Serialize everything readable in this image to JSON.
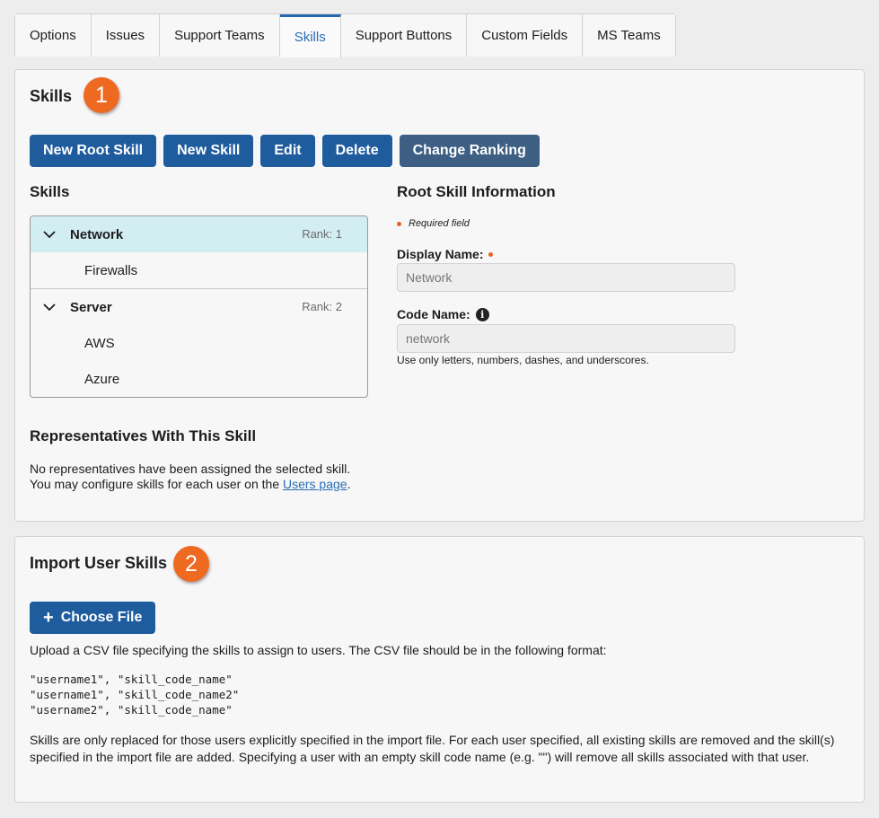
{
  "tabs": [
    "Options",
    "Issues",
    "Support Teams",
    "Skills",
    "Support Buttons",
    "Custom Fields",
    "MS Teams"
  ],
  "active_tab": "Skills",
  "skills_panel": {
    "title": "Skills",
    "badge": "1",
    "buttons": {
      "new_root": "New Root Skill",
      "new_skill": "New Skill",
      "edit": "Edit",
      "delete": "Delete",
      "change_ranking": "Change Ranking"
    },
    "tree_title": "Skills",
    "tree": [
      {
        "name": "Network",
        "rank": "Rank: 1",
        "children": [
          "Firewalls"
        ]
      },
      {
        "name": "Server",
        "rank": "Rank: 2",
        "children": [
          "AWS",
          "Azure"
        ]
      }
    ],
    "info": {
      "title": "Root Skill Information",
      "required": "Required field",
      "display_name_label": "Display Name:",
      "display_name_value": "Network",
      "code_name_label": "Code Name:",
      "code_name_value": "network",
      "hint": "Use only letters, numbers, dashes, and underscores."
    },
    "reps": {
      "title": "Representatives With This Skill",
      "text": "No representatives have been assigned the selected skill. You may configure skills for each user on the ",
      "link": "Users page",
      "after": "."
    }
  },
  "import_panel": {
    "title": "Import User Skills",
    "badge": "2",
    "choose_file": "Choose File",
    "desc": "Upload a CSV file specifying the skills to assign to users. The CSV file should be in the following format:",
    "code_lines": [
      "\"username1\", \"skill_code_name\"",
      "\"username1\", \"skill_code_name2\"",
      "\"username2\", \"skill_code_name\""
    ],
    "note": "Skills are only replaced for those users explicitly specified in the import file. For each user specified, all existing skills are removed and the skill(s) specified in the import file are added. Specifying a user with an empty skill code name (e.g. \"\") will remove all skills associated with that user."
  },
  "colors": {
    "primary": "#1f5c9e",
    "accent_badge": "#ef6a21",
    "selected_row": "#d3eef3"
  }
}
